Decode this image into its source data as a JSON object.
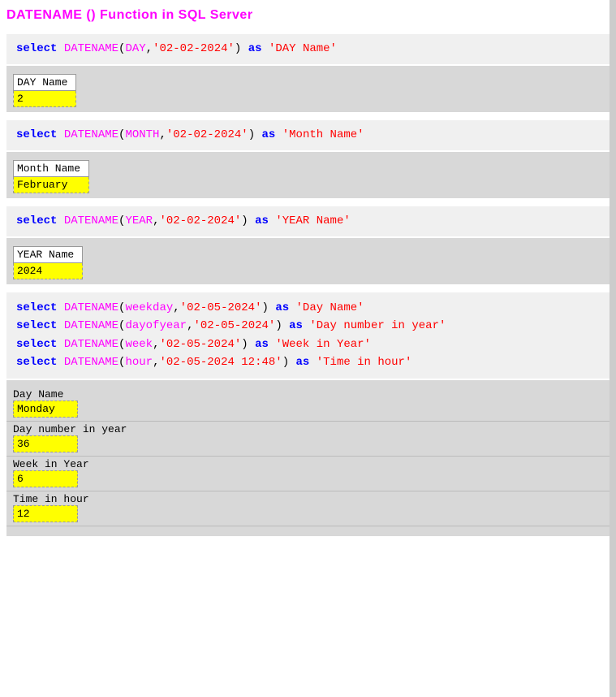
{
  "title": "DATENAME () Function in SQL Server",
  "sections": [
    {
      "id": "day-section",
      "code": {
        "keyword": "select",
        "function": "DATENAME",
        "arg1": "DAY",
        "arg2": "'02-02-2024'",
        "alias_kw": "as",
        "alias_val": "'DAY Name'"
      },
      "result_header": "DAY Name",
      "result_value": "2"
    },
    {
      "id": "month-section",
      "code": {
        "keyword": "select",
        "function": "DATENAME",
        "arg1": "MONTH",
        "arg2": "'02-02-2024'",
        "alias_kw": "as",
        "alias_val": "'Month Name'"
      },
      "result_header": "Month Name",
      "result_value": "February"
    },
    {
      "id": "year-section",
      "code": {
        "keyword": "select",
        "function": "DATENAME",
        "arg1": "YEAR",
        "arg2": "'02-02-2024'",
        "alias_kw": "as",
        "alias_val": "'YEAR Name'"
      },
      "result_header": "YEAR Name",
      "result_value": "2024"
    }
  ],
  "multi_section": {
    "lines": [
      {
        "keyword": "select",
        "function": "DATENAME",
        "arg1": "weekday",
        "arg2": "'02-05-2024'",
        "alias_kw": "as",
        "alias_val": "'Day Name'"
      },
      {
        "keyword": "select",
        "function": "DATENAME",
        "arg1": "dayofyear",
        "arg2": "'02-05-2024'",
        "alias_kw": "as",
        "alias_val": "'Day number in year'"
      },
      {
        "keyword": "select",
        "function": "DATENAME",
        "arg1": "week",
        "arg2": "'02-05-2024'",
        "alias_kw": "as",
        "alias_val": "'Week in Year'"
      },
      {
        "keyword": "select",
        "function": "DATENAME",
        "arg1": "hour",
        "arg2": "'02-05-2024 12:48'",
        "alias_kw": "as",
        "alias_val": "'Time in hour'"
      }
    ],
    "results": [
      {
        "header": "Day Name",
        "value": "Monday"
      },
      {
        "header": "Day number in year",
        "value": "36"
      },
      {
        "header": "Week in Year",
        "value": "6"
      },
      {
        "header": "Time in hour",
        "value": "12"
      }
    ]
  }
}
